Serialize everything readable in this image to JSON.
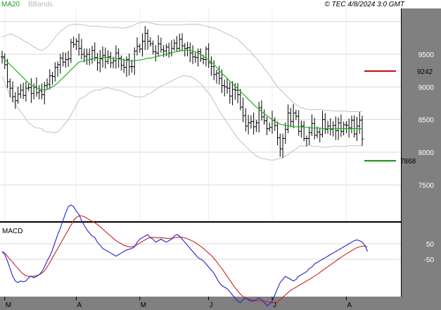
{
  "header": {
    "legend_ma20": "MA20",
    "legend_bbands": "BBands",
    "copyright": "© TEC 4/8/2024 3:0 GMT"
  },
  "colors": {
    "background": "#ffffff",
    "axis_panel": "#808080",
    "ma20": "#22b022",
    "bbands": "#c0c0c0",
    "price_bars": "#000000",
    "macd_line": "#2222cc",
    "signal_line": "#cc2222",
    "resistance": "#cc0000",
    "support": "#118811"
  },
  "chart_data": [
    {
      "type": "ohlc",
      "panel": "price",
      "ylim": [
        7000,
        10000
      ],
      "yticks": [
        7500,
        8000,
        8500,
        9000,
        9500
      ],
      "yticklabels": [
        "7500",
        "8000",
        "8500",
        "9000",
        "9500"
      ],
      "xticklabels": [
        "M",
        "A",
        "M",
        "J",
        "J",
        "A"
      ],
      "xtick_index": [
        1,
        28,
        52,
        78,
        102,
        130
      ],
      "grid": true,
      "close": [
        9460,
        9340,
        9080,
        8980,
        8850,
        8790,
        8890,
        8950,
        8870,
        8980,
        8990,
        8900,
        9000,
        8910,
        8940,
        8880,
        9020,
        9040,
        9170,
        9160,
        9300,
        9340,
        9440,
        9380,
        9420,
        9430,
        9680,
        9650,
        9700,
        9590,
        9500,
        9470,
        9500,
        9420,
        9560,
        9450,
        9370,
        9430,
        9480,
        9390,
        9460,
        9370,
        9400,
        9520,
        9440,
        9330,
        9300,
        9420,
        9310,
        9310,
        9550,
        9620,
        9580,
        9700,
        9820,
        9700,
        9660,
        9540,
        9520,
        9660,
        9570,
        9550,
        9610,
        9520,
        9590,
        9670,
        9590,
        9730,
        9630,
        9590,
        9600,
        9520,
        9460,
        9450,
        9540,
        9430,
        9420,
        9580,
        9370,
        9310,
        9190,
        9210,
        9130,
        9020,
        9000,
        8980,
        8860,
        8960,
        8950,
        8880,
        8690,
        8560,
        8400,
        8450,
        8470,
        8390,
        8450,
        8680,
        8540,
        8480,
        8360,
        8380,
        8490,
        8410,
        8220,
        8050,
        8210,
        8350,
        8600,
        8470,
        8600,
        8550,
        8320,
        8400,
        8210,
        8210,
        8300,
        8440,
        8260,
        8310,
        8270,
        8500,
        8350,
        8400,
        8350,
        8410,
        8330,
        8450,
        8320,
        8420,
        8410,
        8370,
        8490,
        8280,
        8400,
        8490,
        8200
      ],
      "ma20": [
        9460,
        9420,
        9380,
        9340,
        9300,
        9260,
        9220,
        9180,
        9140,
        9100,
        9060,
        9030,
        9000,
        8980,
        8970,
        8960,
        8950,
        8960,
        8980,
        9000,
        9030,
        9060,
        9100,
        9140,
        9180,
        9220,
        9260,
        9300,
        9340,
        9380,
        9390,
        9400,
        9410,
        9420,
        9430,
        9440,
        9440,
        9440,
        9450,
        9450,
        9450,
        9440,
        9440,
        9430,
        9430,
        9420,
        9410,
        9410,
        9400,
        9400,
        9400,
        9410,
        9410,
        9420,
        9430,
        9440,
        9440,
        9450,
        9460,
        9470,
        9480,
        9490,
        9500,
        9510,
        9520,
        9530,
        9540,
        9550,
        9560,
        9560,
        9560,
        9560,
        9550,
        9540,
        9520,
        9500,
        9470,
        9440,
        9410,
        9380,
        9340,
        9300,
        9250,
        9210,
        9170,
        9130,
        9090,
        9050,
        9010,
        8970,
        8930,
        8890,
        8850,
        8810,
        8770,
        8730,
        8690,
        8660,
        8620,
        8590,
        8560,
        8530,
        8500,
        8470,
        8450,
        8430,
        8420,
        8410,
        8400,
        8400,
        8390,
        8390,
        8390,
        8390,
        8380,
        8380,
        8380,
        8370,
        8370,
        8370,
        8370,
        8360,
        8360,
        8360,
        8360,
        8360,
        8360,
        8360,
        8360,
        8360,
        8360,
        8360,
        8360,
        8360,
        8360,
        8360,
        8360
      ],
      "bb_upper": [
        9760,
        9780,
        9800,
        9810,
        9800,
        9780,
        9760,
        9740,
        9710,
        9690,
        9670,
        9640,
        9610,
        9590,
        9570,
        9560,
        9580,
        9610,
        9650,
        9700,
        9760,
        9810,
        9850,
        9880,
        9910,
        9940,
        9950,
        9960,
        9960,
        9960,
        9950,
        9950,
        9940,
        9930,
        9930,
        9930,
        9930,
        9930,
        9920,
        9920,
        9910,
        9910,
        9910,
        9910,
        9910,
        9900,
        9900,
        9910,
        9920,
        9930,
        9950,
        9970,
        9980,
        9990,
        10000,
        9990,
        9980,
        9970,
        9960,
        9960,
        9950,
        9950,
        9950,
        9950,
        9950,
        9950,
        9950,
        9950,
        9950,
        9950,
        9960,
        9960,
        9960,
        9960,
        9960,
        9950,
        9940,
        9930,
        9920,
        9910,
        9900,
        9890,
        9870,
        9850,
        9830,
        9810,
        9790,
        9770,
        9750,
        9730,
        9690,
        9650,
        9610,
        9570,
        9530,
        9480,
        9440,
        9390,
        9340,
        9280,
        9230,
        9180,
        9120,
        9060,
        9000,
        8960,
        8920,
        8880,
        8840,
        8800,
        8760,
        8730,
        8700,
        8680,
        8670,
        8660,
        8650,
        8650,
        8650,
        8650,
        8650,
        8650,
        8640,
        8640,
        8640,
        8630,
        8630,
        8630,
        8630,
        8630,
        8630,
        8620,
        8620,
        8620,
        8620,
        8620,
        8620
      ],
      "bb_lower": [
        9160,
        9060,
        8960,
        8870,
        8800,
        8740,
        8680,
        8620,
        8570,
        8510,
        8450,
        8420,
        8390,
        8370,
        8370,
        8360,
        8320,
        8310,
        8310,
        8300,
        8300,
        8310,
        8350,
        8400,
        8450,
        8500,
        8570,
        8640,
        8720,
        8800,
        8830,
        8850,
        8880,
        8910,
        8930,
        8950,
        8950,
        8950,
        8980,
        8980,
        8990,
        8970,
        8970,
        8950,
        8950,
        8940,
        8920,
        8910,
        8880,
        8870,
        8850,
        8850,
        8840,
        8850,
        8860,
        8890,
        8900,
        8930,
        8960,
        8980,
        9010,
        9030,
        9050,
        9070,
        9090,
        9110,
        9130,
        9150,
        9170,
        9170,
        9160,
        9160,
        9140,
        9120,
        9080,
        9050,
        9000,
        8950,
        8900,
        8850,
        8780,
        8710,
        8630,
        8570,
        8510,
        8450,
        8390,
        8330,
        8270,
        8210,
        8170,
        8130,
        8090,
        8050,
        8010,
        7980,
        7940,
        7930,
        7900,
        7900,
        7890,
        7880,
        7880,
        7880,
        7900,
        7900,
        7920,
        7940,
        7960,
        8000,
        8020,
        8050,
        8080,
        8100,
        8090,
        8100,
        8110,
        8090,
        8090,
        8090,
        8090,
        8070,
        8080,
        8080,
        8080,
        8090,
        8090,
        8090,
        8090,
        8090,
        8090,
        8100,
        8100,
        8100,
        8100,
        8100,
        8100
      ]
    },
    {
      "type": "line",
      "panel": "macd",
      "title": "MACD",
      "yticks": [
        50,
        -50
      ],
      "yticklabels": [
        "50",
        "-50"
      ],
      "ylim": [
        -350,
        350
      ],
      "macd": [
        0,
        -20,
        -60,
        -110,
        -160,
        -190,
        -200,
        -190,
        -195,
        -190,
        -170,
        -160,
        -170,
        -160,
        -150,
        -130,
        -100,
        -60,
        -30,
        10,
        60,
        110,
        150,
        200,
        250,
        290,
        300,
        290,
        260,
        240,
        200,
        170,
        140,
        120,
        100,
        90,
        60,
        40,
        20,
        10,
        0,
        -10,
        -20,
        -30,
        -20,
        -10,
        0,
        10,
        15,
        20,
        30,
        60,
        80,
        90,
        100,
        110,
        90,
        80,
        60,
        70,
        80,
        70,
        60,
        70,
        80,
        100,
        110,
        100,
        80,
        60,
        40,
        20,
        0,
        -20,
        -40,
        -50,
        -60,
        -80,
        -100,
        -120,
        -140,
        -170,
        -200,
        -220,
        -230,
        -240,
        -260,
        -280,
        -300,
        -320,
        -330,
        -310,
        -300,
        -310,
        -320,
        -320,
        -310,
        -300,
        -310,
        -330,
        -350,
        -340,
        -320,
        -280,
        -240,
        -200,
        -180,
        -160,
        -170,
        -180,
        -190,
        -180,
        -160,
        -150,
        -140,
        -130,
        -110,
        -100,
        -80,
        -70,
        -60,
        -50,
        -40,
        -30,
        -20,
        -10,
        0,
        10,
        20,
        30,
        40,
        50,
        60,
        70,
        75,
        70,
        60,
        40,
        0
      ],
      "signal": [
        0,
        -10,
        -30,
        -50,
        -70,
        -90,
        -110,
        -130,
        -145,
        -155,
        -160,
        -160,
        -160,
        -155,
        -150,
        -140,
        -125,
        -100,
        -70,
        -40,
        -10,
        20,
        50,
        80,
        110,
        140,
        170,
        200,
        220,
        230,
        230,
        225,
        215,
        205,
        195,
        185,
        175,
        160,
        145,
        130,
        115,
        100,
        85,
        70,
        60,
        50,
        40,
        35,
        30,
        30,
        35,
        45,
        55,
        65,
        75,
        85,
        90,
        92,
        90,
        88,
        88,
        88,
        85,
        85,
        85,
        88,
        92,
        94,
        92,
        88,
        82,
        75,
        67,
        57,
        45,
        33,
        20,
        5,
        -10,
        -25,
        -45,
        -65,
        -90,
        -110,
        -135,
        -160,
        -185,
        -210,
        -235,
        -255,
        -275,
        -290,
        -300,
        -305,
        -310,
        -315,
        -318,
        -318,
        -318,
        -320,
        -325,
        -328,
        -330,
        -330,
        -325,
        -310,
        -295,
        -280,
        -265,
        -250,
        -240,
        -230,
        -220,
        -210,
        -200,
        -190,
        -180,
        -170,
        -158,
        -148,
        -135,
        -122,
        -110,
        -98,
        -86,
        -74,
        -62,
        -50,
        -38,
        -26,
        -15,
        -5,
        5,
        15,
        25,
        30,
        35,
        35,
        30
      ]
    }
  ],
  "annotations": {
    "resistance_value": 9242,
    "resistance_label": "9242",
    "support_value": 7868,
    "support_label": "7868"
  }
}
